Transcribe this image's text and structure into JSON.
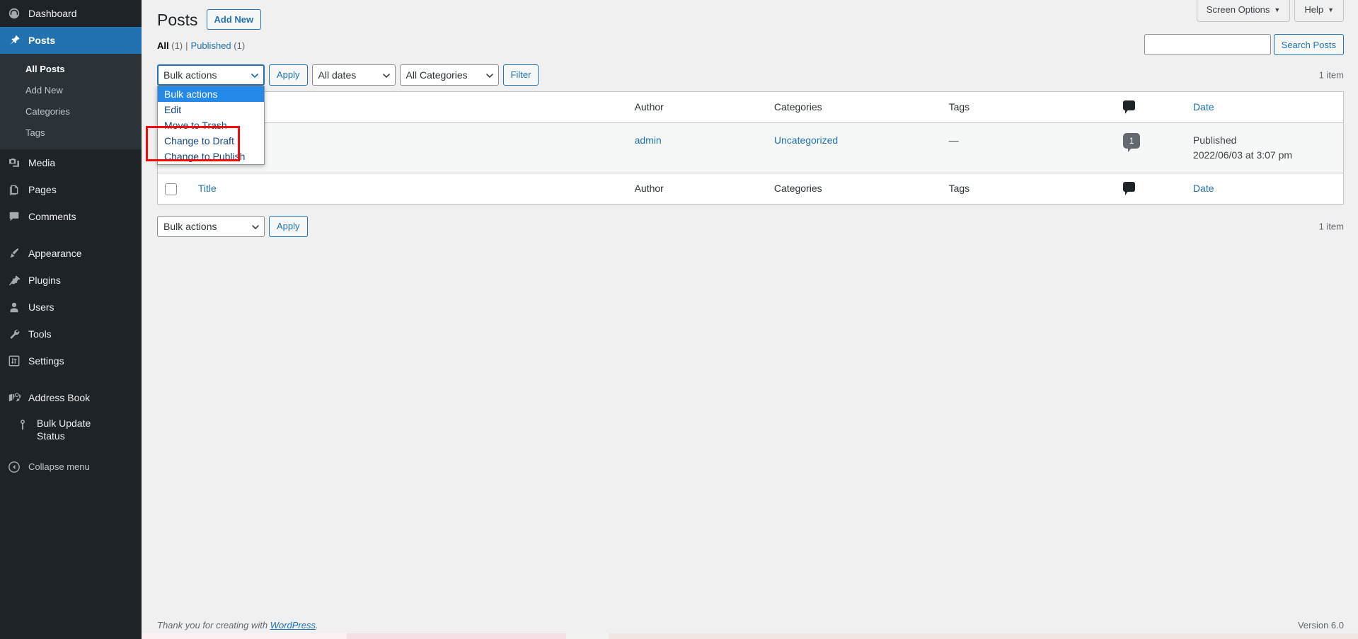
{
  "colors": {
    "sidebar_bg": "#1d2327",
    "submenu_bg": "#2c3338",
    "accent_blue": "#2271b1",
    "highlight_red": "#f50b0b",
    "dropdown_selected": "#2489e8",
    "row_bg": "#f6f7f7",
    "page_bg": "#f0f0f1"
  },
  "sidebar": {
    "items": [
      {
        "label": "Dashboard",
        "icon": "dashboard-icon",
        "current": false
      },
      {
        "label": "Posts",
        "icon": "pin-icon",
        "current": true
      },
      {
        "label": "Media",
        "icon": "media-icon",
        "current": false
      },
      {
        "label": "Pages",
        "icon": "pages-icon",
        "current": false
      },
      {
        "label": "Comments",
        "icon": "comments-icon",
        "current": false
      },
      {
        "label": "Appearance",
        "icon": "paintbrush-icon",
        "current": false
      },
      {
        "label": "Plugins",
        "icon": "plug-icon",
        "current": false
      },
      {
        "label": "Users",
        "icon": "user-icon",
        "current": false
      },
      {
        "label": "Tools",
        "icon": "wrench-icon",
        "current": false
      },
      {
        "label": "Settings",
        "icon": "settings-sliders-icon",
        "current": false
      },
      {
        "label": "Address Book",
        "icon": "book-map-icon",
        "current": false
      },
      {
        "label": "Bulk Update Status",
        "icon": "pin-marker-icon",
        "current": false
      }
    ],
    "posts_submenu": [
      {
        "label": "All Posts",
        "current": true
      },
      {
        "label": "Add New",
        "current": false
      },
      {
        "label": "Categories",
        "current": false
      },
      {
        "label": "Tags",
        "current": false
      }
    ],
    "collapse": {
      "label": "Collapse menu",
      "icon": "collapse-arrow-icon"
    }
  },
  "header": {
    "screen_options": "Screen Options",
    "help": "Help",
    "caret": "▼"
  },
  "page": {
    "title": "Posts",
    "add_new": "Add New"
  },
  "views": {
    "all_label": "All",
    "all_count": "(1)",
    "divider": "|",
    "published_label": "Published",
    "published_count": "(1)"
  },
  "search": {
    "value": "",
    "placeholder": "",
    "button": "Search Posts"
  },
  "tablenav_top": {
    "bulk_actions_value": "Bulk actions",
    "apply": "Apply",
    "dates_value": "All dates",
    "categories_value": "All Categories",
    "filter": "Filter",
    "count": "1 item"
  },
  "tablenav_bottom": {
    "bulk_actions_value": "Bulk actions",
    "apply": "Apply",
    "count": "1 item"
  },
  "bulk_dropdown": {
    "open": true,
    "options": [
      {
        "label": "Bulk actions",
        "selected": true
      },
      {
        "label": "Edit",
        "selected": false
      },
      {
        "label": "Move to Trash",
        "selected": false
      },
      {
        "label": "Change to Draft",
        "selected": false
      },
      {
        "label": "Change to Publish",
        "selected": false
      }
    ],
    "highlight_options": [
      "Change to Draft",
      "Change to Publish"
    ]
  },
  "table": {
    "columns": {
      "title": "Title",
      "author": "Author",
      "categories": "Categories",
      "tags": "Tags",
      "comments": "comment-bubble-icon",
      "date": "Date"
    },
    "rows": [
      {
        "title": "",
        "author": "admin",
        "categories": "Uncategorized",
        "tags": "—",
        "comments_count": "1",
        "date_status": "Published",
        "date_value": "2022/06/03 at 3:07 pm"
      }
    ]
  },
  "footer": {
    "thanks_prefix": "Thank you for creating with ",
    "wordpress_link": "WordPress",
    "thanks_suffix": ".",
    "version": "Version 6.0"
  }
}
